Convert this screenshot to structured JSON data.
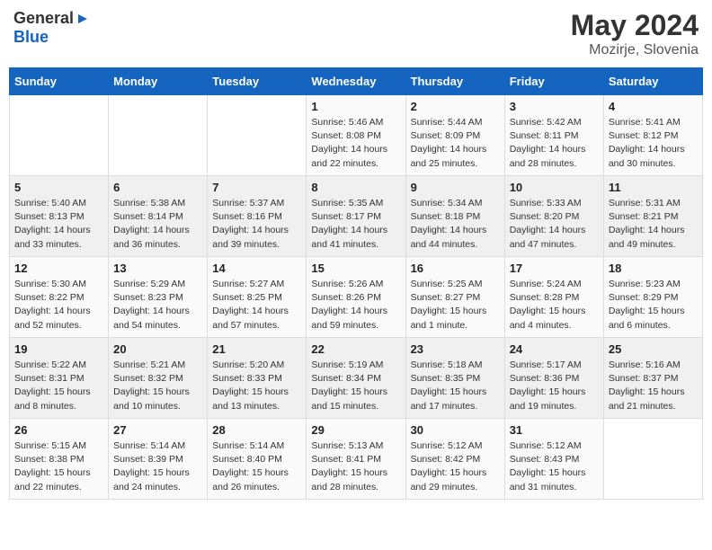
{
  "header": {
    "logo_general": "General",
    "logo_blue": "Blue",
    "month_year": "May 2024",
    "location": "Mozirje, Slovenia"
  },
  "weekdays": [
    "Sunday",
    "Monday",
    "Tuesday",
    "Wednesday",
    "Thursday",
    "Friday",
    "Saturday"
  ],
  "weeks": [
    [
      {
        "day": "",
        "info": ""
      },
      {
        "day": "",
        "info": ""
      },
      {
        "day": "",
        "info": ""
      },
      {
        "day": "1",
        "info": "Sunrise: 5:46 AM\nSunset: 8:08 PM\nDaylight: 14 hours and 22 minutes."
      },
      {
        "day": "2",
        "info": "Sunrise: 5:44 AM\nSunset: 8:09 PM\nDaylight: 14 hours and 25 minutes."
      },
      {
        "day": "3",
        "info": "Sunrise: 5:42 AM\nSunset: 8:11 PM\nDaylight: 14 hours and 28 minutes."
      },
      {
        "day": "4",
        "info": "Sunrise: 5:41 AM\nSunset: 8:12 PM\nDaylight: 14 hours and 30 minutes."
      }
    ],
    [
      {
        "day": "5",
        "info": "Sunrise: 5:40 AM\nSunset: 8:13 PM\nDaylight: 14 hours and 33 minutes."
      },
      {
        "day": "6",
        "info": "Sunrise: 5:38 AM\nSunset: 8:14 PM\nDaylight: 14 hours and 36 minutes."
      },
      {
        "day": "7",
        "info": "Sunrise: 5:37 AM\nSunset: 8:16 PM\nDaylight: 14 hours and 39 minutes."
      },
      {
        "day": "8",
        "info": "Sunrise: 5:35 AM\nSunset: 8:17 PM\nDaylight: 14 hours and 41 minutes."
      },
      {
        "day": "9",
        "info": "Sunrise: 5:34 AM\nSunset: 8:18 PM\nDaylight: 14 hours and 44 minutes."
      },
      {
        "day": "10",
        "info": "Sunrise: 5:33 AM\nSunset: 8:20 PM\nDaylight: 14 hours and 47 minutes."
      },
      {
        "day": "11",
        "info": "Sunrise: 5:31 AM\nSunset: 8:21 PM\nDaylight: 14 hours and 49 minutes."
      }
    ],
    [
      {
        "day": "12",
        "info": "Sunrise: 5:30 AM\nSunset: 8:22 PM\nDaylight: 14 hours and 52 minutes."
      },
      {
        "day": "13",
        "info": "Sunrise: 5:29 AM\nSunset: 8:23 PM\nDaylight: 14 hours and 54 minutes."
      },
      {
        "day": "14",
        "info": "Sunrise: 5:27 AM\nSunset: 8:25 PM\nDaylight: 14 hours and 57 minutes."
      },
      {
        "day": "15",
        "info": "Sunrise: 5:26 AM\nSunset: 8:26 PM\nDaylight: 14 hours and 59 minutes."
      },
      {
        "day": "16",
        "info": "Sunrise: 5:25 AM\nSunset: 8:27 PM\nDaylight: 15 hours and 1 minute."
      },
      {
        "day": "17",
        "info": "Sunrise: 5:24 AM\nSunset: 8:28 PM\nDaylight: 15 hours and 4 minutes."
      },
      {
        "day": "18",
        "info": "Sunrise: 5:23 AM\nSunset: 8:29 PM\nDaylight: 15 hours and 6 minutes."
      }
    ],
    [
      {
        "day": "19",
        "info": "Sunrise: 5:22 AM\nSunset: 8:31 PM\nDaylight: 15 hours and 8 minutes."
      },
      {
        "day": "20",
        "info": "Sunrise: 5:21 AM\nSunset: 8:32 PM\nDaylight: 15 hours and 10 minutes."
      },
      {
        "day": "21",
        "info": "Sunrise: 5:20 AM\nSunset: 8:33 PM\nDaylight: 15 hours and 13 minutes."
      },
      {
        "day": "22",
        "info": "Sunrise: 5:19 AM\nSunset: 8:34 PM\nDaylight: 15 hours and 15 minutes."
      },
      {
        "day": "23",
        "info": "Sunrise: 5:18 AM\nSunset: 8:35 PM\nDaylight: 15 hours and 17 minutes."
      },
      {
        "day": "24",
        "info": "Sunrise: 5:17 AM\nSunset: 8:36 PM\nDaylight: 15 hours and 19 minutes."
      },
      {
        "day": "25",
        "info": "Sunrise: 5:16 AM\nSunset: 8:37 PM\nDaylight: 15 hours and 21 minutes."
      }
    ],
    [
      {
        "day": "26",
        "info": "Sunrise: 5:15 AM\nSunset: 8:38 PM\nDaylight: 15 hours and 22 minutes."
      },
      {
        "day": "27",
        "info": "Sunrise: 5:14 AM\nSunset: 8:39 PM\nDaylight: 15 hours and 24 minutes."
      },
      {
        "day": "28",
        "info": "Sunrise: 5:14 AM\nSunset: 8:40 PM\nDaylight: 15 hours and 26 minutes."
      },
      {
        "day": "29",
        "info": "Sunrise: 5:13 AM\nSunset: 8:41 PM\nDaylight: 15 hours and 28 minutes."
      },
      {
        "day": "30",
        "info": "Sunrise: 5:12 AM\nSunset: 8:42 PM\nDaylight: 15 hours and 29 minutes."
      },
      {
        "day": "31",
        "info": "Sunrise: 5:12 AM\nSunset: 8:43 PM\nDaylight: 15 hours and 31 minutes."
      },
      {
        "day": "",
        "info": ""
      }
    ]
  ]
}
